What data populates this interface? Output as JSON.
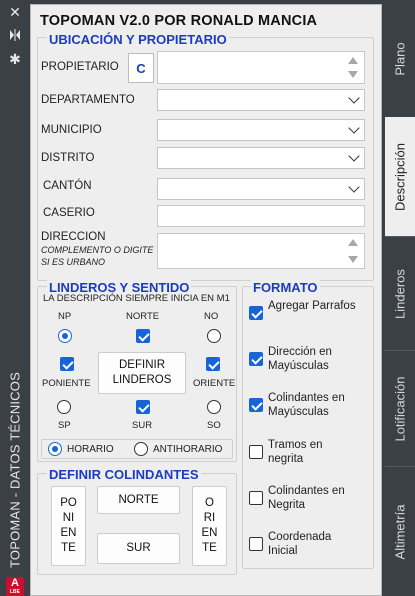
{
  "app": {
    "vertical_title": "TOPOMAN - DATOS TÉCNICOS",
    "logo_text": "A",
    "logo_sub": "LBE"
  },
  "panel": {
    "title": "TOPOMAN V2.0 POR RONALD MANCIA"
  },
  "ubicacion": {
    "heading": "UBICACIÓN Y PROPIETARIO",
    "propietario_label": "PROPIETARIO",
    "c_button": "C",
    "propietario_value": "",
    "departamento_label": "DEPARTAMENTO",
    "departamento_value": "",
    "municipio_label": "MUNICIPIO",
    "municipio_value": "",
    "distrito_label": "DISTRITO",
    "distrito_value": "",
    "canton_label": "CANTÓN",
    "canton_value": "",
    "caserio_label": "CASERIO",
    "caserio_value": "",
    "direccion_label": "DIRECCION",
    "direccion_hint": "COMPLEMENTO O DIGITE SI ES URBANO",
    "direccion_value": ""
  },
  "linderos": {
    "heading": "LINDEROS Y SENTIDO",
    "note": "LA DESCRIPCIÓN SIEMPRE INICIA EN M1",
    "np": "NP",
    "norte": "NORTE",
    "no": "NO",
    "poniente": "PONIENTE",
    "oriente": "ORIENTE",
    "sp": "SP",
    "sur": "SUR",
    "so": "SO",
    "definir_button": "DEFINIR LINDEROS",
    "horario": "HORARIO",
    "antihorario": "ANTIHORARIO"
  },
  "colindantes": {
    "heading": "DEFINIR COLINDANTES",
    "poniente_btn": "PO NI EN TE",
    "norte_btn": "NORTE",
    "sur_btn": "SUR",
    "oriente_btn": "O RI EN TE"
  },
  "formato": {
    "heading": "FORMATO",
    "items": [
      {
        "label": "Agregar Parrafos",
        "checked": true
      },
      {
        "label": "Dirección en Mayúsculas",
        "checked": true
      },
      {
        "label": "Colindantes en Mayúsculas",
        "checked": true
      },
      {
        "label": "Tramos en negrita",
        "checked": false
      },
      {
        "label": "Colindantes en Negrita",
        "checked": false
      },
      {
        "label": "Coordenada Inicial",
        "checked": false
      }
    ]
  },
  "tabs": [
    {
      "label": "Plano",
      "active": false
    },
    {
      "label": "Descripción",
      "active": true
    },
    {
      "label": "Linderos",
      "active": false
    },
    {
      "label": "Lotificación",
      "active": false
    },
    {
      "label": "Altimetría",
      "active": false
    }
  ],
  "colors": {
    "accent_blue": "#1565d8",
    "heading_blue": "#1a3cc4",
    "dark_bg": "#3b3f46",
    "panel_bg": "#eeeeee"
  }
}
